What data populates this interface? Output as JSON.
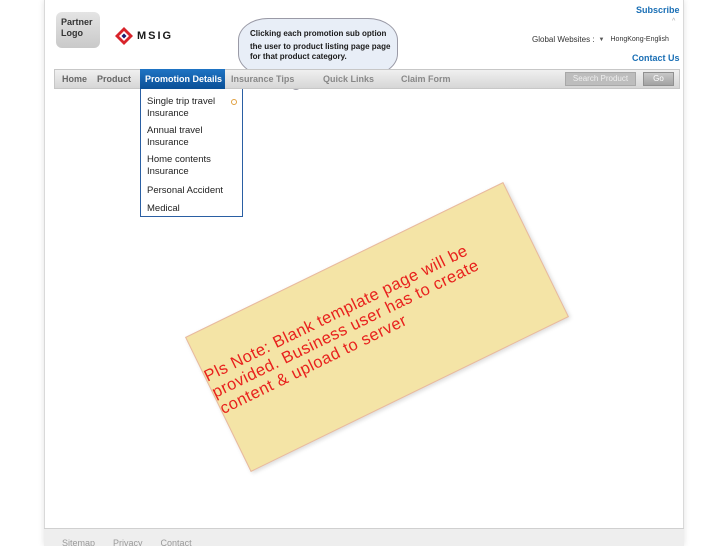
{
  "header": {
    "partner_logo": "Partner\nLogo",
    "brand_name": "MSIG",
    "subscribe": "Subscribe",
    "tiny_marker": "^",
    "global_websites_label": "Global Websites :",
    "global_websites_value": "HongKong-English",
    "contact_us": "Contact Us"
  },
  "callout": {
    "line1": "Clicking each promotion sub option",
    "line2": "the user  to product listing page  page",
    "line3": "for that product category."
  },
  "nav": {
    "items": [
      "Home",
      "Product",
      "Promotion Details",
      "Insurance Tips",
      "Quick Links",
      "Claim Form"
    ],
    "search_placeholder": "Search Product",
    "go_label": "Go"
  },
  "dropdown": {
    "items": [
      "Single trip travel Insurance",
      "Annual travel Insurance",
      "Home contents Insurance",
      "Personal Accident",
      "Medical"
    ]
  },
  "note": {
    "text": "Pls Note: Blank template page will be provided. Business user has to create content & upload to server"
  },
  "footer": {
    "links": [
      "Sitemap",
      "Privacy",
      "Contact"
    ]
  },
  "colors": {
    "accent_blue": "#1a6fb5",
    "nav_active": "#0a4f96",
    "note_bg": "#f4e4a6",
    "note_text": "#e8211d",
    "brand_red": "#d8232a"
  }
}
